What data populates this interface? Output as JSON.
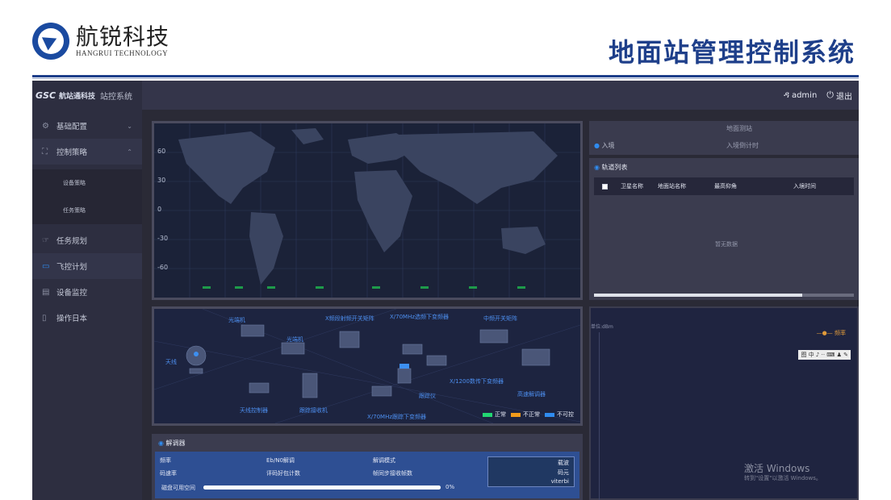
{
  "slide": {
    "logo_cn": "航锐科技",
    "logo_en": "HANGRUI TECHNOLOGY",
    "title": "地面站管理控制系统"
  },
  "topbar": {
    "brand_logo": "GSC",
    "brand_name": "航站通科技",
    "brand_sys": "站控系统",
    "user": "admin",
    "logout": "退出"
  },
  "sidebar": {
    "items": [
      {
        "label": "基础配置",
        "icon": "gear-icon"
      },
      {
        "label": "控制策略",
        "icon": "tree-icon"
      },
      {
        "label": "设备策略",
        "icon": ""
      },
      {
        "label": "任务策略",
        "icon": ""
      },
      {
        "label": "任务规划",
        "icon": "plan-icon"
      },
      {
        "label": "飞控计划",
        "icon": "folder-icon"
      },
      {
        "label": "设备监控",
        "icon": "monitor-icon"
      },
      {
        "label": "操作日本",
        "icon": "doc-icon"
      }
    ]
  },
  "map": {
    "lat_labels": [
      "60",
      "30",
      "0",
      "-30",
      "-60"
    ]
  },
  "network": {
    "labels": {
      "antenna": "天线",
      "optical1": "光端机",
      "optical2": "光端机",
      "xband_switch": "X频段射频开关矩阵",
      "down1": "X/70MHz选频下变频器",
      "mid_switch": "中频开关矩阵",
      "down2": "X/1200数传下变频器",
      "demod": "高速解调器",
      "tracker": "跟踪仪",
      "acu": "天线控制器",
      "track_rx": "跟踪接收机",
      "down3": "X/70MHz跟踪下变频器"
    },
    "legend": [
      {
        "label": "正常",
        "color": "#22d672"
      },
      {
        "label": "不正常",
        "color": "#f09a1a"
      },
      {
        "label": "不可控",
        "color": "#2f8bef"
      }
    ]
  },
  "decoder": {
    "title": "解调器",
    "cells": [
      "频率",
      "Eb/N0解调",
      "解调模式",
      "码速率",
      "评码好包计数",
      "帧同步接收帧数"
    ],
    "box": [
      "载波",
      "码元",
      "viterbi"
    ],
    "disk_label": "磁盘可用空间",
    "disk_percent": "0%",
    "disk_fill": 1.0
  },
  "station": {
    "header": "地面测站",
    "entry": "入境",
    "countdown": "入境倒计时"
  },
  "orbit_table": {
    "title": "轨道列表",
    "columns": [
      "卫星名称",
      "地面站名称",
      "最高仰角",
      "入境时间"
    ],
    "empty": "暂无数据"
  },
  "right_chart": {
    "ylabel": "单位:dBm",
    "legend": "频率",
    "tools": "图 中 ♪ ·· ⌨ ♟ ✎",
    "watermark1": "激活 Windows",
    "watermark2": "转到\"设置\"以激活 Windows。"
  }
}
